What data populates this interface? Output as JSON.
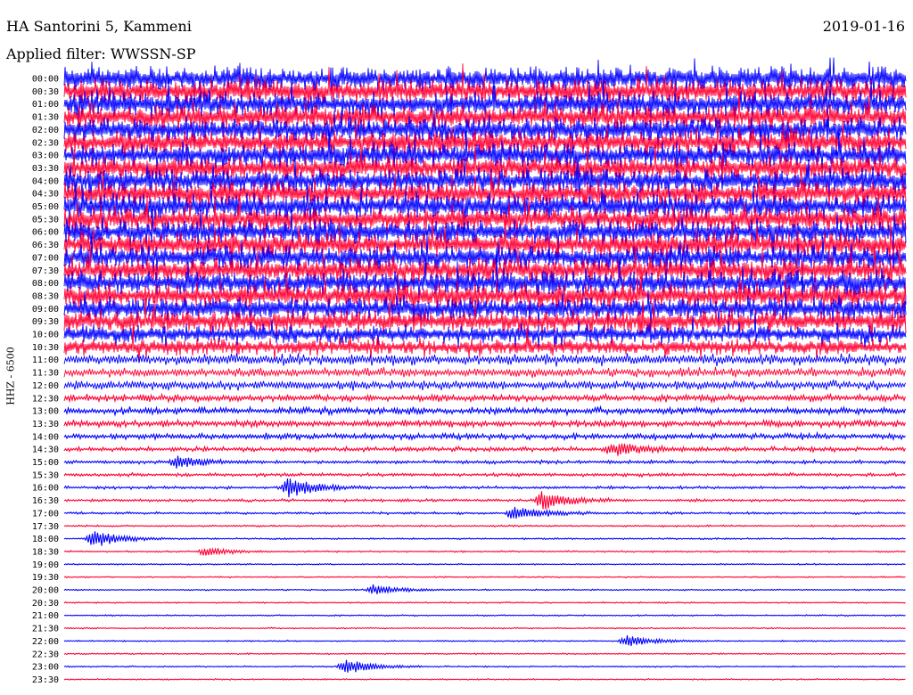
{
  "header": {
    "station": "HA Santorini 5, Kammeni",
    "filter": "Applied filter: WWSSN-SP",
    "date": "2019-01-16"
  },
  "chart_data": {
    "type": "line",
    "title": "HA Santorini 5, Kammeni",
    "subtitle": "Applied filter: WWSSN-SP",
    "date": "2019-01-16",
    "ylabel": "HHZ - 6500",
    "xlabel": "",
    "grid": false,
    "row_interval_minutes": 30,
    "alternating_colors": [
      "#0000ff",
      "#ff0033"
    ],
    "rows": [
      {
        "label": "00:00",
        "amplitude": 1.0
      },
      {
        "label": "00:30",
        "amplitude": 1.0
      },
      {
        "label": "01:00",
        "amplitude": 1.0
      },
      {
        "label": "01:30",
        "amplitude": 1.0
      },
      {
        "label": "02:00",
        "amplitude": 1.0
      },
      {
        "label": "02:30",
        "amplitude": 1.0
      },
      {
        "label": "03:00",
        "amplitude": 1.0
      },
      {
        "label": "03:30",
        "amplitude": 1.0
      },
      {
        "label": "04:00",
        "amplitude": 1.0
      },
      {
        "label": "04:30",
        "amplitude": 1.0
      },
      {
        "label": "05:00",
        "amplitude": 1.0
      },
      {
        "label": "05:30",
        "amplitude": 1.0
      },
      {
        "label": "06:00",
        "amplitude": 1.0
      },
      {
        "label": "06:30",
        "amplitude": 1.0
      },
      {
        "label": "07:00",
        "amplitude": 1.0
      },
      {
        "label": "07:30",
        "amplitude": 1.0
      },
      {
        "label": "08:00",
        "amplitude": 1.0
      },
      {
        "label": "08:30",
        "amplitude": 1.0
      },
      {
        "label": "09:00",
        "amplitude": 0.95
      },
      {
        "label": "09:30",
        "amplitude": 0.9
      },
      {
        "label": "10:00",
        "amplitude": 0.75
      },
      {
        "label": "10:30",
        "amplitude": 0.65
      },
      {
        "label": "11:00",
        "amplitude": 0.5
      },
      {
        "label": "11:30",
        "amplitude": 0.4
      },
      {
        "label": "12:00",
        "amplitude": 0.4
      },
      {
        "label": "12:30",
        "amplitude": 0.3
      },
      {
        "label": "13:00",
        "amplitude": 0.3
      },
      {
        "label": "13:30",
        "amplitude": 0.3
      },
      {
        "label": "14:00",
        "amplitude": 0.25
      },
      {
        "label": "14:30",
        "amplitude": 0.2
      },
      {
        "label": "15:00",
        "amplitude": 0.15
      },
      {
        "label": "15:30",
        "amplitude": 0.15
      },
      {
        "label": "16:00",
        "amplitude": 0.12
      },
      {
        "label": "16:30",
        "amplitude": 0.12
      },
      {
        "label": "17:00",
        "amplitude": 0.1
      },
      {
        "label": "17:30",
        "amplitude": 0.08
      },
      {
        "label": "18:00",
        "amplitude": 0.07
      },
      {
        "label": "18:30",
        "amplitude": 0.07
      },
      {
        "label": "19:00",
        "amplitude": 0.06
      },
      {
        "label": "19:30",
        "amplitude": 0.06
      },
      {
        "label": "20:00",
        "amplitude": 0.06
      },
      {
        "label": "20:30",
        "amplitude": 0.06
      },
      {
        "label": "21:00",
        "amplitude": 0.06
      },
      {
        "label": "21:30",
        "amplitude": 0.06
      },
      {
        "label": "22:00",
        "amplitude": 0.06
      },
      {
        "label": "22:30",
        "amplitude": 0.06
      },
      {
        "label": "23:00",
        "amplitude": 0.06
      },
      {
        "label": "23:30",
        "amplitude": 0.06
      }
    ],
    "events": [
      {
        "row": "16:00",
        "minute": 8,
        "amplitude": 0.5
      },
      {
        "row": "16:30",
        "minute": 17,
        "amplitude": 0.5
      },
      {
        "row": "17:00",
        "minute": 16,
        "amplitude": 0.4
      },
      {
        "row": "18:00",
        "minute": 1,
        "amplitude": 0.5
      },
      {
        "row": "18:30",
        "minute": 5,
        "amplitude": 0.2
      },
      {
        "row": "20:00",
        "minute": 11,
        "amplitude": 0.25
      },
      {
        "row": "22:00",
        "minute": 20,
        "amplitude": 0.3
      },
      {
        "row": "23:00",
        "minute": 10,
        "amplitude": 0.4
      },
      {
        "row": "14:30",
        "minute": 19.5,
        "amplitude": 0.35
      },
      {
        "row": "15:00",
        "minute": 4,
        "amplitude": 0.3
      }
    ]
  }
}
